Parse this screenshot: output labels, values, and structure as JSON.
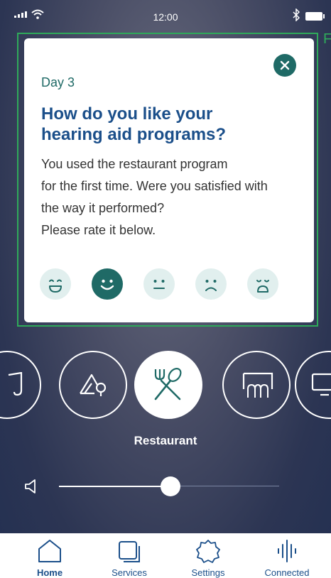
{
  "status_bar": {
    "time": "12:00"
  },
  "highlight": {
    "tag": "F"
  },
  "card": {
    "day": "Day 3",
    "title_line1": "How do you like your",
    "title_line2": "hearing aid programs?",
    "body_lines": [
      "You used the restaurant program",
      "for the first time. Were you satisfied with",
      "the way it performed?",
      "Please rate it below."
    ],
    "rating": {
      "options": [
        "very-happy-face-icon",
        "happy-face-icon",
        "neutral-face-icon",
        "sad-face-icon",
        "very-sad-face-icon"
      ],
      "selected": 1
    }
  },
  "programs": {
    "items": [
      "music-note-icon",
      "outdoor-icon",
      "restaurant-icon",
      "theater-icon",
      "tv-icon"
    ],
    "active_label": "Restaurant"
  },
  "volume": {
    "value": 0.5
  },
  "tabbar": {
    "tabs": [
      {
        "label": "Home",
        "icon": "home-icon"
      },
      {
        "label": "Services",
        "icon": "services-icon"
      },
      {
        "label": "Settings",
        "icon": "settings-icon"
      },
      {
        "label": "Connected",
        "icon": "connected-icon"
      }
    ],
    "active": 0
  },
  "colors": {
    "accent_teal": "#1f6a66",
    "title_blue": "#1b4f8a",
    "face_light": "#e1efee",
    "highlight_green": "#2faa5a"
  }
}
